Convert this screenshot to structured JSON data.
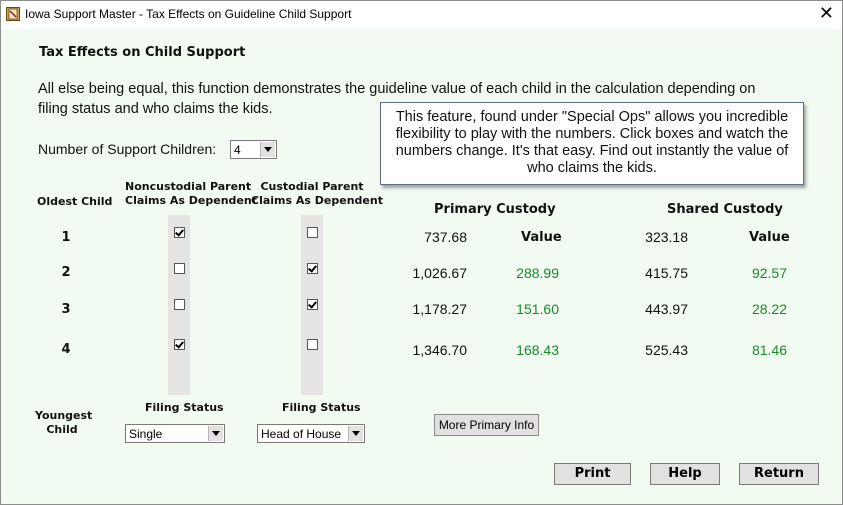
{
  "window": {
    "title": "Iowa Support Master - Tax Effects on Guideline Child Support",
    "close_glyph": "✕",
    "icon": "app-book-icon"
  },
  "content": {
    "heading": "Tax Effects on Child Support",
    "description": "All else being equal, this function demonstrates the guideline value of each child in the calculation depending on filing status and who claims the kids.",
    "num_children_label": "Number of Support Children:",
    "num_children_value": "4",
    "tooltip": "This feature, found under \"Special Ops\" allows you incredible flexibility to play with the numbers. Click boxes and watch the numbers change. It's that easy. Find out instantly the value of who claims the kids."
  },
  "columns": {
    "oldest_child": "Oldest Child",
    "youngest_child_line1": "Youngest",
    "youngest_child_line2": "Child",
    "noncustodial_line1": "Noncustodial Parent",
    "noncustodial_line2": "Claims As Dependent",
    "custodial_line1": "Custodial Parent",
    "custodial_line2": "Claims As Dependent",
    "primary_custody": "Primary Custody",
    "shared_custody": "Shared Custody",
    "value_label": "Value"
  },
  "rows": [
    {
      "num": "1",
      "noncustodial": true,
      "custodial": false,
      "primary": "737.68",
      "primary_value": "",
      "shared": "323.18",
      "shared_value": ""
    },
    {
      "num": "2",
      "noncustodial": false,
      "custodial": true,
      "primary": "1,026.67",
      "primary_value": "288.99",
      "shared": "415.75",
      "shared_value": "92.57"
    },
    {
      "num": "3",
      "noncustodial": false,
      "custodial": true,
      "primary": "1,178.27",
      "primary_value": "151.60",
      "shared": "443.97",
      "shared_value": "28.22"
    },
    {
      "num": "4",
      "noncustodial": true,
      "custodial": false,
      "primary": "1,346.70",
      "primary_value": "168.43",
      "shared": "525.43",
      "shared_value": "81.46"
    }
  ],
  "filing": {
    "label": "Filing Status",
    "noncustodial_value": "Single",
    "custodial_value": "Head of House"
  },
  "buttons": {
    "more_primary": "More Primary Info",
    "print": "Print",
    "help": "Help",
    "return": "Return"
  },
  "colors": {
    "background": "#f1fbf1",
    "value_green": "#1a8a2a"
  }
}
